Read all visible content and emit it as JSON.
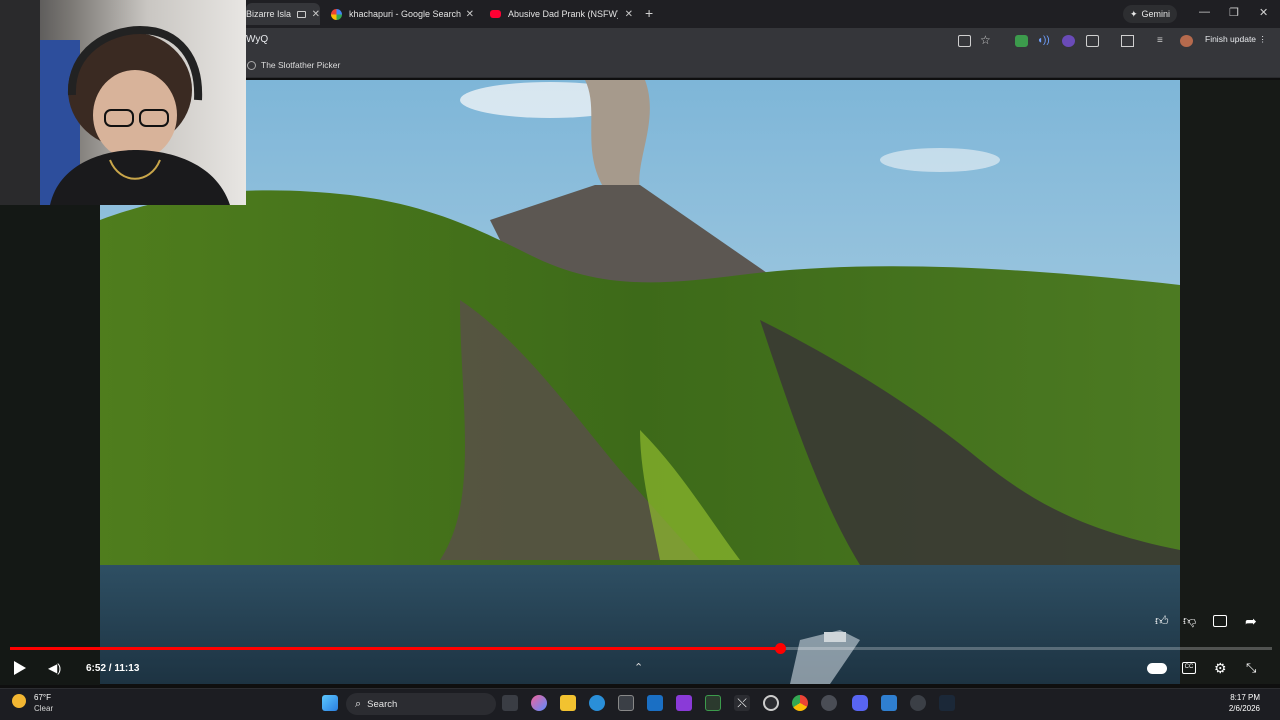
{
  "browser": {
    "tabs": [
      {
        "title": "Bizarre Isla",
        "favicon": "video-tab-icon",
        "active": true
      },
      {
        "title": "khachapuri - Google Search",
        "favicon": "google-icon",
        "active": false
      },
      {
        "title": "Abusive Dad Prank (NSFW) - Yo",
        "favicon": "youtube-icon",
        "active": false
      }
    ],
    "gemini_label": "Gemini",
    "address_text": "WyQ",
    "finish_update_label": "Finish update",
    "bookmark_label": "The Slotfather Picker"
  },
  "player": {
    "time_current": "6:52",
    "time_total": "11:13",
    "time_display": "6:52 / 11:13",
    "progress": 0.61,
    "state": "paused",
    "accent": "#ff0000"
  },
  "taskbar": {
    "weather_temp": "67°F",
    "weather_condition": "Clear",
    "search_placeholder": "Search",
    "time": "8:17 PM",
    "date": "2/6/2026"
  }
}
